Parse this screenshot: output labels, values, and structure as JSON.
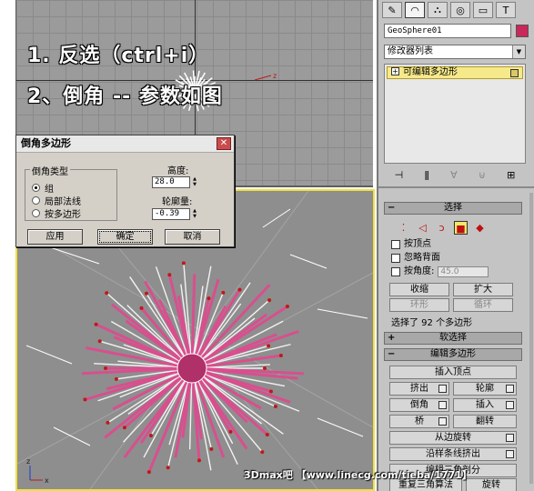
{
  "overlay": {
    "step1": "1. 反选（ctrl+i）",
    "step2": "2、倒角 -- 参数如图"
  },
  "viewport_top": {
    "axis_label": "z"
  },
  "viewport_persp": {
    "axis_x": "x",
    "axis_z": "z"
  },
  "command_panel": {
    "tabs": [
      {
        "icon": "create-icon",
        "glyph": "✎"
      },
      {
        "icon": "modify-icon",
        "glyph": "◠"
      },
      {
        "icon": "hierarchy-icon",
        "glyph": "⛬"
      },
      {
        "icon": "motion-icon",
        "glyph": "◎"
      },
      {
        "icon": "display-icon",
        "glyph": "▭"
      },
      {
        "icon": "utilities-icon",
        "glyph": "T"
      }
    ],
    "object_name": "GeoSphere01",
    "object_color": "#c8285a",
    "modifier_list": "修改器列表",
    "stack_item": "可编辑多边形",
    "selection": {
      "title": "选择",
      "by_vertex": "按顶点",
      "ignore_backfacing": "忽略背面",
      "by_angle": "按角度:",
      "angle_value": "45.0",
      "shrink": "收缩",
      "grow": "扩大",
      "ring": "环形",
      "loop": "循环",
      "status": "选择了 92 个多边形"
    },
    "soft_selection": {
      "title": "软选择"
    },
    "edit_polygons": {
      "title": "编辑多边形",
      "insert_vertex": "插入顶点",
      "extrude": "挤出",
      "outline": "轮廓",
      "bevel": "倒角",
      "inset": "插入",
      "bridge": "桥",
      "flip": "翻转",
      "hinge_from_edge": "从边旋转",
      "extrude_along_spline": "沿样条线挤出",
      "edit_triangulation": "编辑三角剖分",
      "retriangulate": "重复三角算法",
      "turn": "旋转"
    }
  },
  "dialog": {
    "title": "倒角多边形",
    "group_label": "倒角类型",
    "options": [
      "组",
      "局部法线",
      "按多边形"
    ],
    "selected_option": 0,
    "height_label": "高度:",
    "height_value": "28.0",
    "outline_label": "轮廓量:",
    "outline_value": "-0.39",
    "apply": "应用",
    "ok": "确定",
    "cancel": "取消"
  },
  "watermark": "3Dmax吧 【www.linecg.com/tieba/1771】"
}
